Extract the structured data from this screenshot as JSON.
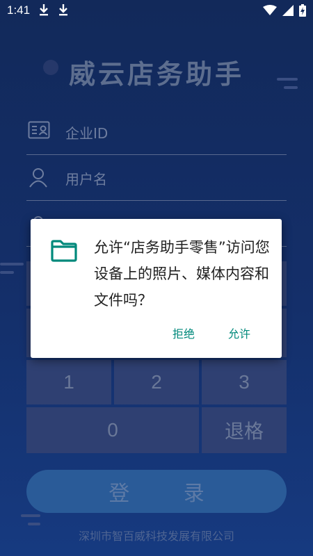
{
  "status_bar": {
    "time": "1:41",
    "icons": [
      "download-icon",
      "download-icon",
      "wifi-icon",
      "signal-icon",
      "battery-charging-icon"
    ]
  },
  "app": {
    "title": "威云店务助手",
    "fields": {
      "enterprise_id_placeholder": "企业ID",
      "username_placeholder": "用户名"
    },
    "keypad": {
      "k1": "1",
      "k2": "2",
      "k3": "3",
      "k0": "0",
      "backspace": "退格"
    },
    "login_label": "登 录",
    "footer": "深圳市智百威科技发展有限公司"
  },
  "dialog": {
    "message": "允许“店务助手零售”访问您设备上的照片、媒体内容和文件吗？",
    "deny": "拒绝",
    "allow": "允许",
    "icon": "folder-icon",
    "accent": "#00897b"
  }
}
